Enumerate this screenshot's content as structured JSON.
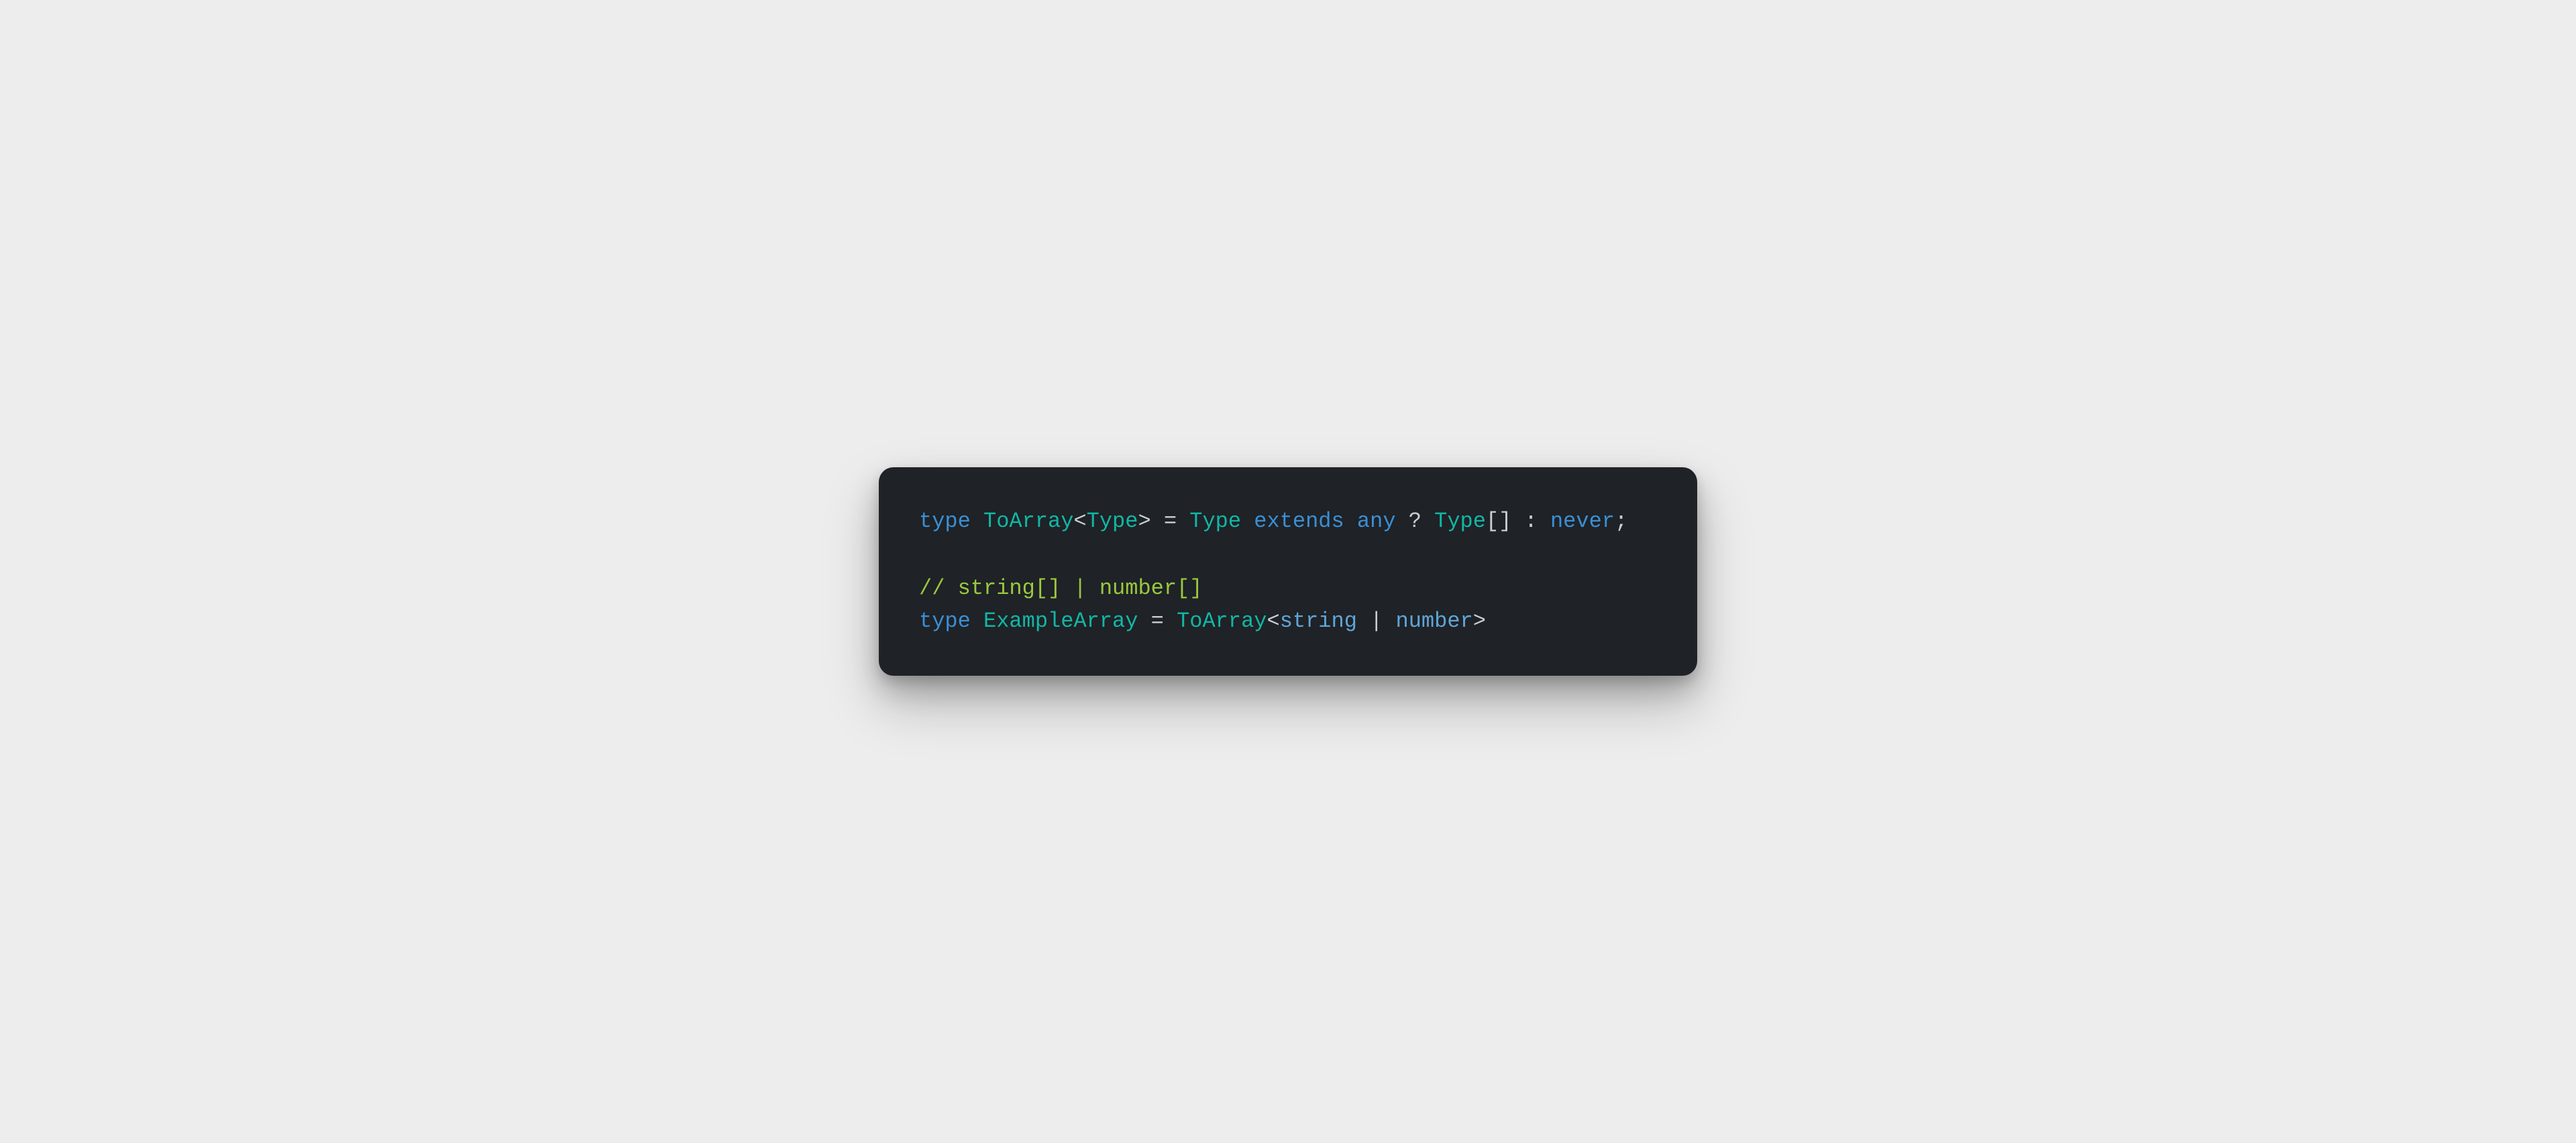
{
  "colors": {
    "background": "#ededed",
    "card": "#1f2226",
    "keyword": "#3a8fd6",
    "className": "#11b7a6",
    "punctuation": "#c9cfd6",
    "comment": "#9ac840",
    "builtinType": "#5fa6d8"
  },
  "code": {
    "line1": {
      "t1": "type",
      "t2": " ",
      "t3": "ToArray",
      "t4": "<",
      "t5": "Type",
      "t6": ">",
      "t7": " = ",
      "t8": "Type",
      "t9": " ",
      "t10": "extends",
      "t11": " ",
      "t12": "any",
      "t13": " ? ",
      "t14": "Type",
      "t15": "[] : ",
      "t16": "never",
      "t17": ";"
    },
    "line2": "",
    "line3": {
      "t1": "// string[] | number[]"
    },
    "line4": {
      "t1": "type",
      "t2": " ",
      "t3": "ExampleArray",
      "t4": " = ",
      "t5": "ToArray",
      "t6": "<",
      "t7": "string",
      "t8": " | ",
      "t9": "number",
      "t10": ">"
    }
  }
}
